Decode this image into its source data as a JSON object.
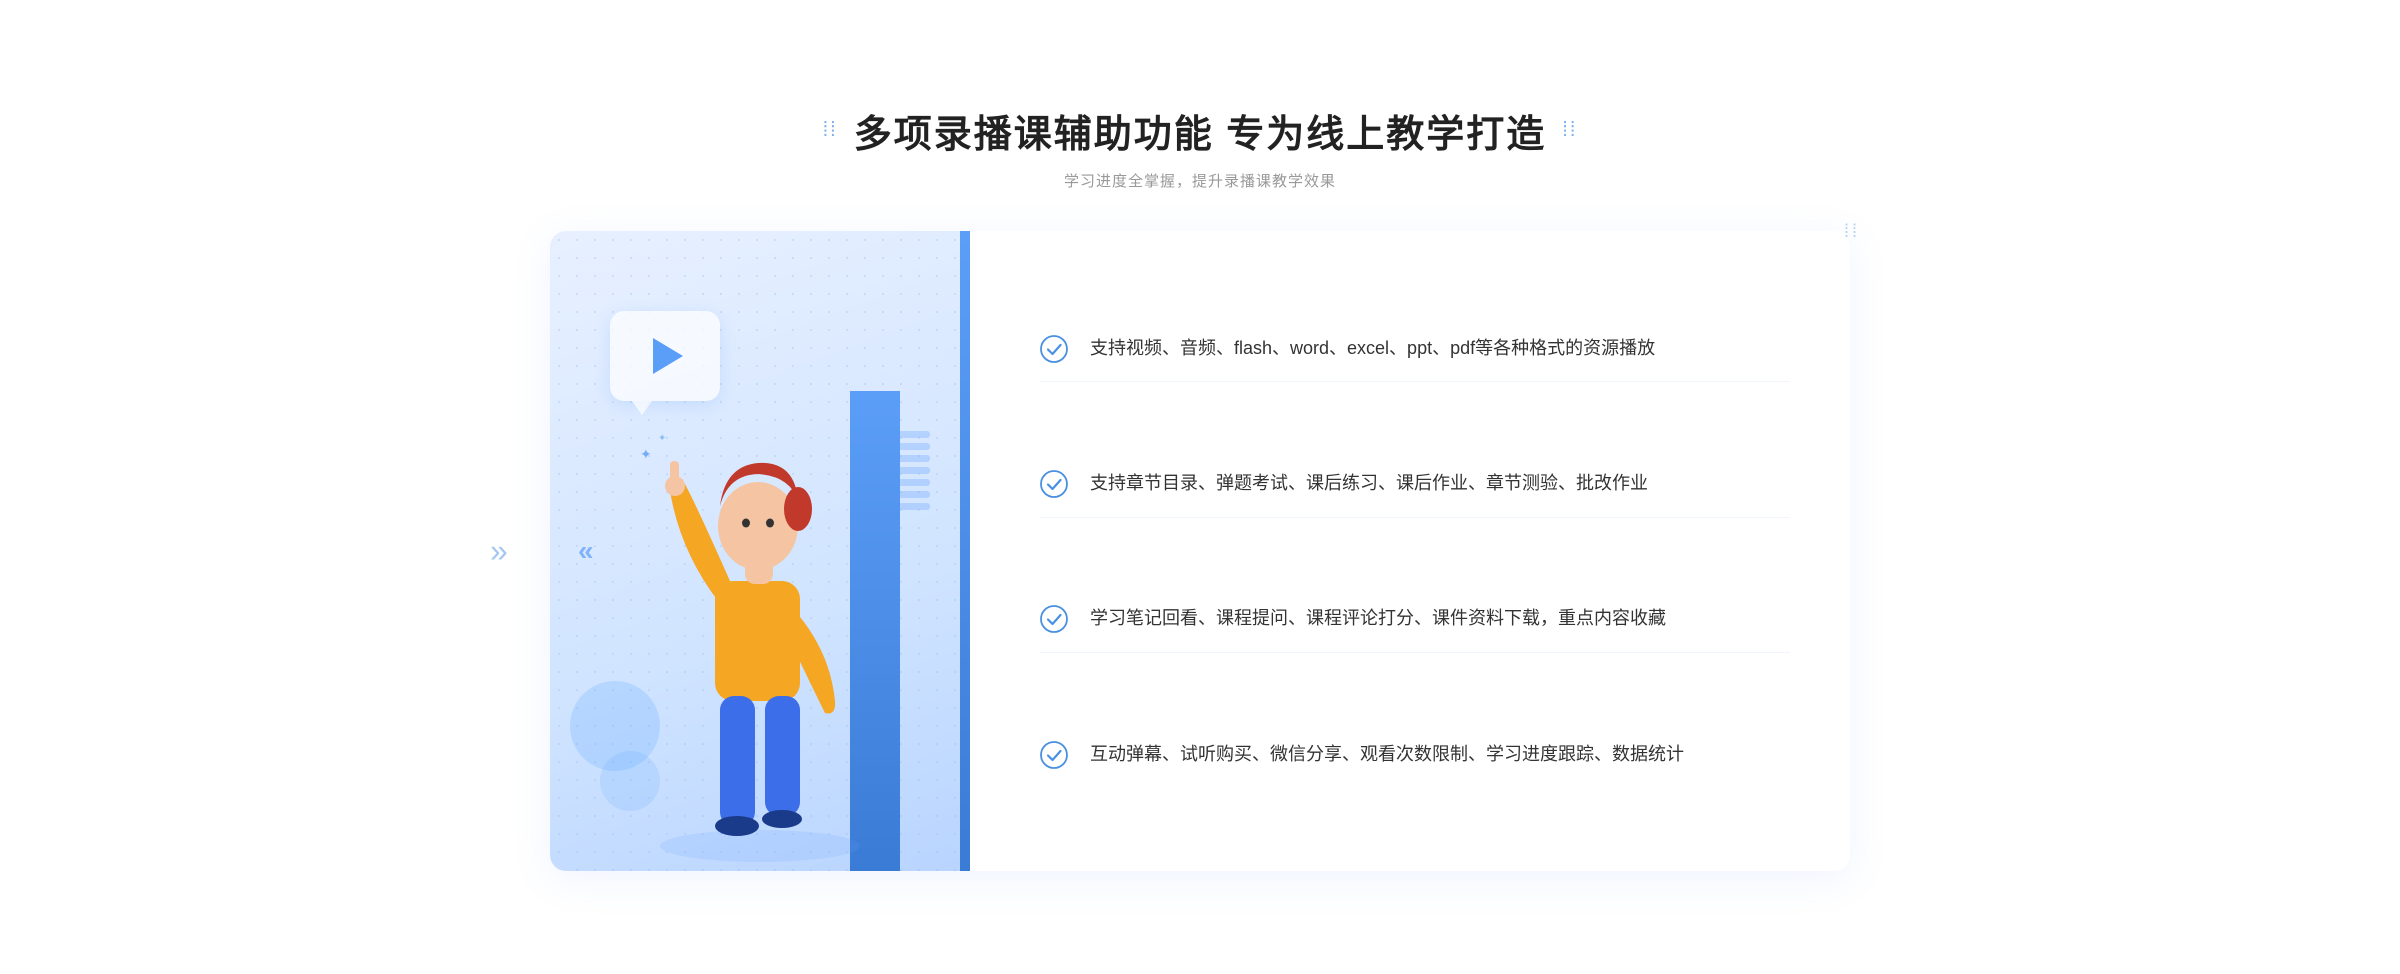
{
  "header": {
    "title": "多项录播课辅助功能 专为线上教学打造",
    "subtitle": "学习进度全掌握，提升录播课教学效果",
    "dots_left": "⁞⁞",
    "dots_right": "⁞⁞"
  },
  "features": [
    {
      "id": "feature-1",
      "text": "支持视频、音频、flash、word、excel、ppt、pdf等各种格式的资源播放"
    },
    {
      "id": "feature-2",
      "text": "支持章节目录、弹题考试、课后练习、课后作业、章节测验、批改作业"
    },
    {
      "id": "feature-3",
      "text": "学习笔记回看、课程提问、课程评论打分、课件资料下载，重点内容收藏"
    },
    {
      "id": "feature-4",
      "text": "互动弹幕、试听购买、微信分享、观看次数限制、学习进度跟踪、数据统计"
    }
  ],
  "colors": {
    "accent": "#4a90e2",
    "accent_dark": "#3a7bd5",
    "title": "#222222",
    "subtitle": "#999999",
    "feature_text": "#333333",
    "check_color": "#4a90e2"
  },
  "outer_chevron": "»",
  "inner_chevron": "«"
}
